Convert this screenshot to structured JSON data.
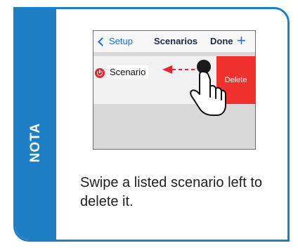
{
  "note": {
    "label": "NOTA",
    "message": "Swipe a listed scenario left to delete it."
  },
  "screenshot": {
    "nav": {
      "back_label": "Setup",
      "title": "Scenarios",
      "done_label": "Done",
      "add_glyph": "+"
    },
    "row": {
      "label": "Scenario",
      "delete_label": "Delete"
    },
    "icons": {
      "back": "chevron-left-icon",
      "add": "plus-icon",
      "power": "power-icon",
      "gesture": "swipe-hand-icon"
    }
  },
  "colors": {
    "accent": "#1f7fc4",
    "delete": "#f0312d",
    "ios_blue": "#1a6fd8",
    "arrow": "#e3262f"
  }
}
